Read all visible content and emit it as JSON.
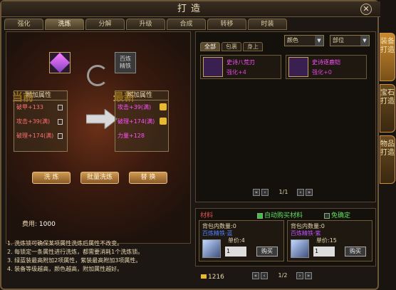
{
  "window": {
    "title": "打造"
  },
  "tabs": [
    {
      "label": "强化"
    },
    {
      "label": "洗炼"
    },
    {
      "label": "分解"
    },
    {
      "label": "升级"
    },
    {
      "label": "合成"
    },
    {
      "label": "转移"
    },
    {
      "label": "时装"
    }
  ],
  "reforge": {
    "target_label": "百炼\n精铁",
    "current_label": "当前",
    "new_label": "最新",
    "panel_header": "附加属性",
    "current_attrs": [
      {
        "text": "破甲+133",
        "color": "#ff7070"
      },
      {
        "text": "攻击+39(满)",
        "color": "#ff7070"
      },
      {
        "text": "破理+174(满)",
        "color": "#ff7070"
      }
    ],
    "new_attrs": [
      {
        "text": "攻击+39(满)",
        "color": "#ff50ff"
      },
      {
        "text": "破理+174(满)",
        "color": "#ff50ff"
      },
      {
        "text": "力量+128",
        "color": "#ff50ff"
      }
    ],
    "buttons": {
      "reforge": "洗 炼",
      "batch": "批量洗炼",
      "replace": "替 换"
    },
    "cost_label": "费用:",
    "cost_value": "1000"
  },
  "notes": [
    "1. 洗炼锁可确保某项属性洗炼后属性不改变。",
    "2. 每锁定一条属性进行洗炼，都需要消耗1个洗炼锁。",
    "3. 绿蓝装最高附加2项属性，紫装最高附加3项属性。",
    "4. 装备等级越高，颜色越高，附加属性越好。"
  ],
  "inventory": {
    "tabs": [
      {
        "label": "全部"
      },
      {
        "label": "包裹"
      },
      {
        "label": "身上"
      }
    ],
    "filter_color": "颜色",
    "filter_slot": "部位",
    "items": [
      {
        "name": "史诗八荒刃",
        "stat": "强化+4"
      },
      {
        "name": "史诗逐鹿铠",
        "stat": "强化+0"
      }
    ],
    "page": "1/1"
  },
  "materials": {
    "title": "材料",
    "auto_buy": "自动购买材料",
    "bind_free": "免确定",
    "boxes": [
      {
        "count": "背包内数量:0",
        "name": "百炼精铁·蓝",
        "price_label": "单价:4",
        "qty": "1",
        "buy": "购买"
      },
      {
        "count": "背包内数量:0",
        "name": "百炼精铁·紫",
        "price_label": "单价:15",
        "qty": "1",
        "buy": "购买"
      }
    ],
    "gold": "1216",
    "page": "1/2"
  },
  "side_tabs": [
    {
      "label": "装备打造"
    },
    {
      "label": "宝石打造"
    },
    {
      "label": "物品打造"
    }
  ]
}
